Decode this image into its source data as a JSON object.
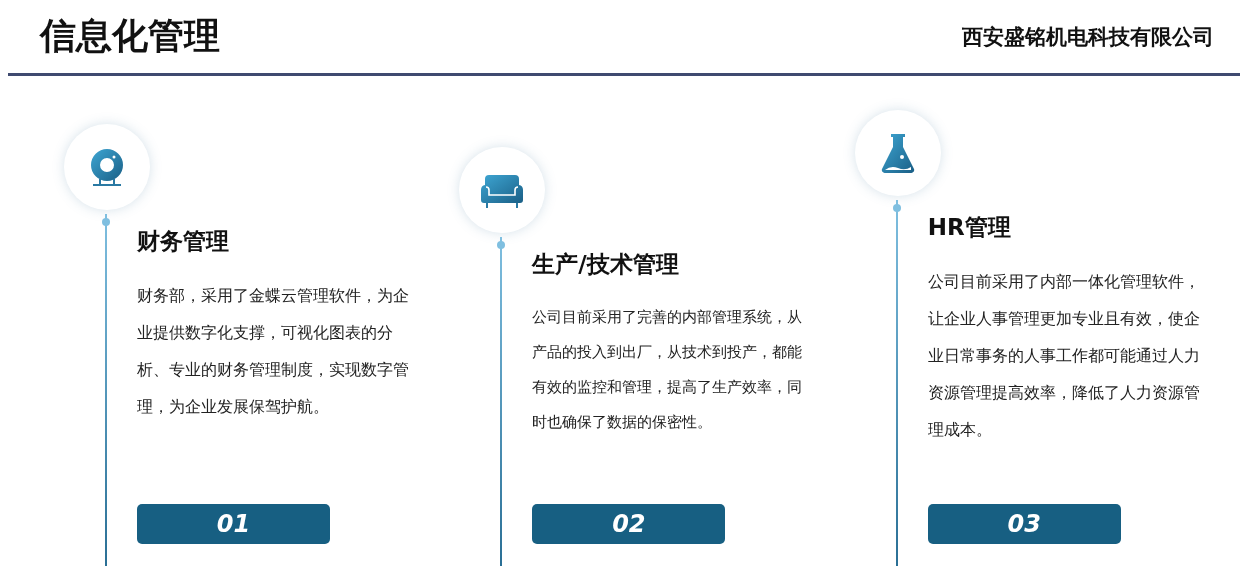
{
  "header": {
    "title": "信息化管理",
    "company": "西安盛铭机电科技有限公司"
  },
  "sections": [
    {
      "kind": "donut",
      "title": "财务管理",
      "text": "财务部，采用了金蝶云管理软件，为企业提供数字化支撑，可视化图表的分析、专业的财务管理制度，实现数字管理，为企业发展保驾护航。",
      "number": "01"
    },
    {
      "kind": "sofa",
      "title": "生产/技术管理",
      "text": "公司目前采用了完善的内部管理系统，从产品的投入到出厂，从技术到投产，都能有效的监控和管理，提高了生产效率，同时也确保了数据的保密性。",
      "number": "02"
    },
    {
      "kind": "flask",
      "title": "HR管理",
      "text": "公司目前采用了内部一体化管理软件，让企业人事管理更加专业且有效，使企业日常事务的人事工作都可能通过人力资源管理提高效率，降低了人力资源管理成本。",
      "number": "03"
    }
  ]
}
